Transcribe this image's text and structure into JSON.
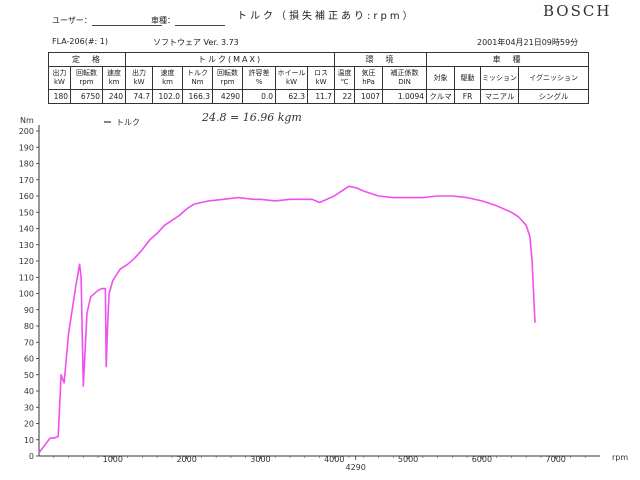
{
  "header": {
    "title": "トルク（損失補正あり:rpm）",
    "brand": "BOSCH",
    "user_label": "ユーザー：",
    "vehicle_label": "車種：",
    "model_line": "FLA-206(#: 1)",
    "software_line": "ソフトウェア Ver. 3.73",
    "datetime": "2001年04月21日09時59分"
  },
  "spec_table": {
    "groups": [
      "定　格",
      "トルク(MAX)",
      "環　境",
      "車　種"
    ],
    "headers": [
      {
        "name": "出力",
        "unit": "kW"
      },
      {
        "name": "回転数",
        "unit": "rpm"
      },
      {
        "name": "速度",
        "unit": "km"
      },
      {
        "name": "出力",
        "unit": "kW"
      },
      {
        "name": "速度",
        "unit": "km"
      },
      {
        "name": "トルク",
        "unit": "Nm"
      },
      {
        "name": "回転数",
        "unit": "rpm"
      },
      {
        "name": "許容差",
        "unit": "%"
      },
      {
        "name": "ホイール",
        "unit": "kW"
      },
      {
        "name": "ロス",
        "unit": "kW"
      },
      {
        "name": "温度",
        "unit": "℃"
      },
      {
        "name": "気圧",
        "unit": "hPa"
      },
      {
        "name": "補正係数",
        "unit": "DIN"
      },
      {
        "name": "対象",
        "unit": ""
      },
      {
        "name": "駆動",
        "unit": ""
      },
      {
        "name": "ミッション",
        "unit": ""
      },
      {
        "name": "イグニッション",
        "unit": ""
      }
    ],
    "values": [
      "180",
      "6750",
      "240",
      "74.7",
      "102.0",
      "166.3",
      "4290",
      "0.0",
      "62.3",
      "11.7",
      "22",
      "1007",
      "1.0094",
      "クルマ",
      "FR",
      "マニアル",
      "シングル"
    ]
  },
  "annotation": "24.8 = 16.96 kgm",
  "chart_data": {
    "type": "line",
    "title": "トルク（損失補正あり:rpm）",
    "xlabel": "rpm",
    "ylabel": "Nm",
    "xlim": [
      0,
      7600
    ],
    "ylim": [
      0,
      200
    ],
    "x_ticks": [
      1000,
      2000,
      3000,
      4000,
      5000,
      6000,
      7000
    ],
    "x_marker": 4290,
    "y_ticks": [
      0,
      10,
      20,
      30,
      40,
      50,
      60,
      70,
      80,
      90,
      100,
      110,
      120,
      130,
      140,
      150,
      160,
      170,
      180,
      190,
      200
    ],
    "grid": false,
    "legend_position": "top-left",
    "line_color": "#ef4fef",
    "series": [
      {
        "name": "トルク",
        "x": [
          0,
          100,
          150,
          200,
          260,
          300,
          340,
          400,
          450,
          500,
          550,
          570,
          600,
          650,
          700,
          800,
          850,
          900,
          910,
          930,
          950,
          1000,
          1100,
          1200,
          1300,
          1400,
          1500,
          1600,
          1700,
          1800,
          1900,
          2000,
          2100,
          2200,
          2300,
          2500,
          2700,
          2900,
          3000,
          3200,
          3400,
          3500,
          3700,
          3800,
          3900,
          4000,
          4100,
          4200,
          4300,
          4400,
          4600,
          4800,
          5000,
          5200,
          5400,
          5600,
          5800,
          6000,
          6200,
          6400,
          6500,
          6600,
          6650,
          6680,
          6700,
          6720
        ],
        "y": [
          2,
          8,
          11,
          11,
          12,
          50,
          45,
          75,
          90,
          105,
          118,
          110,
          43,
          88,
          98,
          102,
          103,
          103,
          55,
          80,
          100,
          108,
          115,
          118,
          122,
          127,
          133,
          137,
          142,
          145,
          148,
          152,
          155,
          156,
          157,
          158,
          159,
          158,
          158,
          157,
          158,
          158,
          158,
          156,
          158,
          160,
          163,
          166,
          165,
          163,
          160,
          159,
          159,
          159,
          160,
          160,
          159,
          157,
          154,
          150,
          147,
          142,
          135,
          120,
          100,
          82
        ]
      }
    ],
    "legend": [
      "トルク"
    ]
  }
}
